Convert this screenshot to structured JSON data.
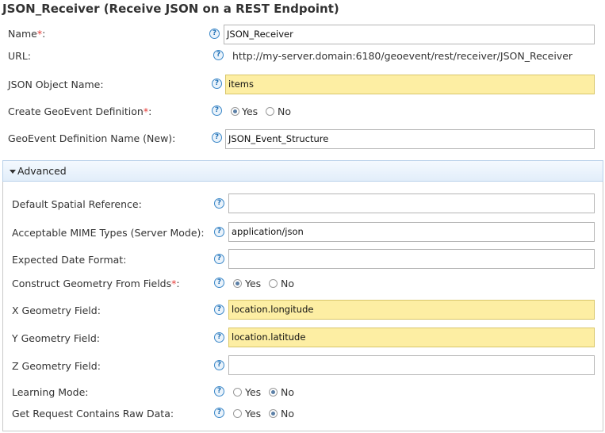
{
  "header": {
    "title": "JSON_Receiver (Receive JSON on a REST Endpoint)"
  },
  "help_glyph": "?",
  "required_mark": "*",
  "general": {
    "name": {
      "label": "Name",
      "value": "JSON_Receiver"
    },
    "url": {
      "label": "URL:",
      "value": "http://my-server.domain:6180/geoevent/rest/receiver/JSON_Receiver"
    },
    "json_object_name": {
      "label": "JSON Object Name:",
      "value": "items"
    },
    "create_definition": {
      "label": "Create GeoEvent Definition",
      "yes": "Yes",
      "no": "No",
      "selected": "Yes"
    },
    "definition_name": {
      "label": "GeoEvent Definition Name (New):",
      "value": "JSON_Event_Structure"
    }
  },
  "advanced": {
    "section_label": "Advanced",
    "expanded": true,
    "spatial_reference": {
      "label": "Default Spatial Reference:",
      "value": ""
    },
    "mime_types": {
      "label": "Acceptable MIME Types (Server Mode):",
      "value": "application/json"
    },
    "date_format": {
      "label": "Expected Date Format:",
      "value": ""
    },
    "construct_geometry": {
      "label": "Construct Geometry From Fields",
      "yes": "Yes",
      "no": "No",
      "selected": "Yes"
    },
    "x_field": {
      "label": "X Geometry Field:",
      "value": "location.longitude"
    },
    "y_field": {
      "label": "Y Geometry Field:",
      "value": "location.latitude"
    },
    "z_field": {
      "label": "Z Geometry Field:",
      "value": ""
    },
    "learning_mode": {
      "label": "Learning Mode:",
      "yes": "Yes",
      "no": "No",
      "selected": "No"
    },
    "raw_data": {
      "label": "Get Request Contains Raw Data:",
      "yes": "Yes",
      "no": "No",
      "selected": "No"
    }
  },
  "colors": {
    "highlight": "#fdeea3",
    "required": "#e53935",
    "help": "#1f6fb5",
    "section_header": "#e2eefa"
  }
}
